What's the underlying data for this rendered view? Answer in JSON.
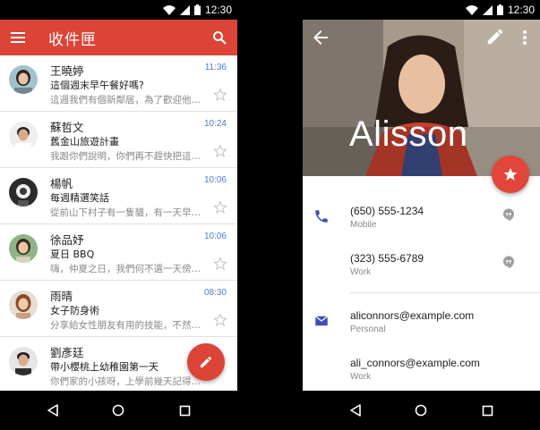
{
  "status": {
    "time": "12:30"
  },
  "colors": {
    "inbox_accent": "#db4437",
    "time_blue": "#4a7bd0",
    "contact_icon": "#3f51b5"
  },
  "inbox": {
    "title": "收件匣",
    "icons": {
      "menu": "menu-icon",
      "search": "search-icon",
      "compose": "pencil-icon"
    },
    "mails": [
      {
        "sender": "王曉婷",
        "subject": "這個週末早午餐好嗎?",
        "snippet": "這週我們有個新鄰居，為了歡迎他…",
        "time": "11:36"
      },
      {
        "sender": "蘇哲文",
        "subject": "舊金山旅遊計畫",
        "snippet": "我跟你們說明，你們再不趕快把這…",
        "time": "10:24"
      },
      {
        "sender": "楊帆",
        "subject": "每週精選笑話",
        "snippet": "從前山下村子有一隻貓，有一天早…",
        "time": "10:06"
      },
      {
        "sender": "徐品妤",
        "subject": "夏日 BBQ",
        "snippet": "嗨，仲夏之日，我們何不選一天傍…",
        "time": "10:06"
      },
      {
        "sender": "雨晴",
        "subject": "女子防身術",
        "snippet": "分享給女性朋友有用的技能，不然…",
        "time": "08:30"
      },
      {
        "sender": "劉彥廷",
        "subject": "帶小櫻桃上幼稚園第一天",
        "snippet": "你們家的小孩呀，上學前幾天記得…",
        "time": ""
      }
    ]
  },
  "contact": {
    "name": "Alisson",
    "icons": {
      "back": "arrow-back-icon",
      "edit": "pencil-icon",
      "more": "more-vert-icon",
      "favorite": "star-icon"
    },
    "phones": [
      {
        "number": "(650) 555-1234",
        "type": "Mobile"
      },
      {
        "number": "(323) 555-6789",
        "type": "Work"
      }
    ],
    "emails": [
      {
        "address": "aliconnors@example.com",
        "type": "Personal"
      },
      {
        "address": "ali_connors@example.com",
        "type": "Work"
      }
    ]
  },
  "navbar": {
    "icons": [
      "back-triangle-icon",
      "home-circle-icon",
      "recents-square-icon"
    ]
  }
}
